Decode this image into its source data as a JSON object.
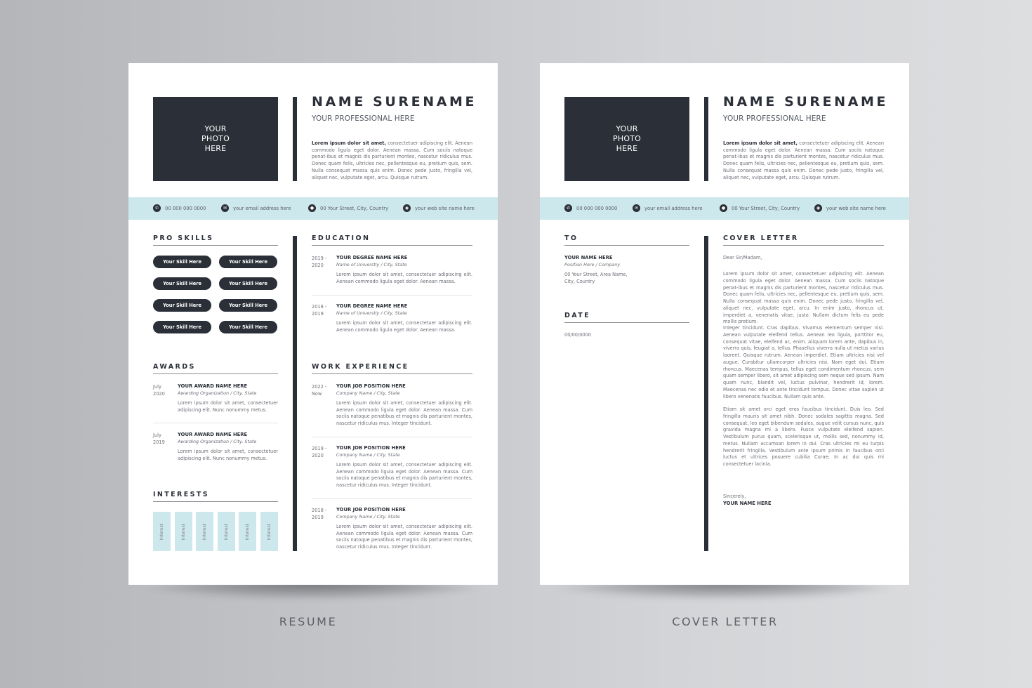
{
  "colors": {
    "dark": "#2b2f38",
    "accent_light_blue": "#cde8ec",
    "text_muted": "#6b6f76",
    "background_left": "#b5b6ba",
    "background_right": "#dddee0"
  },
  "header": {
    "photo_placeholder": "YOUR\nPHOTO\nHERE",
    "name": "NAME SURENAME",
    "profession": "YOUR PROFESSIONAL HERE",
    "intro_bold": "Lorem ipsum dolor sit amet,",
    "intro_rest": " consectetuer adipiscing elit. Aenean commodo ligula eget dolor. Aenean massa. Cum sociis natoque penat-ibus et magnis dis parturient montes, nascetur ridiculus mus. Donec quam felis, ultricies nec, pellentesque eu, pretium quis, sem. Nulla consequat massa quis enim. Donec pede justo, fringilla vel, aliquet nec, vulputate eget, arcu. Quisque rutrum."
  },
  "contact": [
    {
      "icon": "phone-icon",
      "glyph": "✆",
      "text": "00 000 000 0000"
    },
    {
      "icon": "email-icon",
      "glyph": "✉",
      "text": "your email address here"
    },
    {
      "icon": "location-pin-icon",
      "glyph": "●",
      "text": "00 Your Street, City, Country"
    },
    {
      "icon": "globe-icon",
      "glyph": "◉",
      "text": "your web site name here"
    }
  ],
  "resume": {
    "skills_title": "PRO SKILLS",
    "skills": [
      "Your Skill Here",
      "Your Skill Here",
      "Your Skill Here",
      "Your Skill Here",
      "Your Skill Here",
      "Your Skill Here",
      "Your Skill Here",
      "Your Skill Here"
    ],
    "awards_title": "AWARDS",
    "awards": [
      {
        "date": "July\n2020",
        "title": "YOUR AWARD NAME HERE",
        "org": "Awarding Organization / City, State",
        "desc": "Lorem ipsum dolor sit amet, consectetuer adipiscing elit. Nunc nonummy metus."
      },
      {
        "date": "July\n2019",
        "title": "YOUR AWARD NAME HERE",
        "org": "Awarding Organization / City, State",
        "desc": "Lorem ipsum dolor sit amet, consectetuer adipiscing elit. Nunc nonummy metus."
      }
    ],
    "interests_title": "INTERESTS",
    "interests": [
      "Interest",
      "Interest",
      "Interest",
      "Interest",
      "Interest",
      "Interest"
    ],
    "education_title": "EDUCATION",
    "education": [
      {
        "date": "2019 -\n2020",
        "title": "YOUR DEGREE NAME HERE",
        "school": "Name of Universtiy / City, State",
        "desc": "Lorem ipsum dolor sit amet, consectetuer adipiscing elit. Aenean commodo ligula eget dolor. Aenean massa."
      },
      {
        "date": "2018 -\n2019",
        "title": "YOUR DEGREE NAME HERE",
        "school": "Name of Universtiy / City, State",
        "desc": "Lorem ipsum dolor sit amet, consectetuer adipiscing elit. Aenean commodo ligula eget dolor. Aenean massa."
      }
    ],
    "work_title": "WORK EXPERIENCE",
    "work": [
      {
        "date": "2022 -\nNow",
        "title": "YOUR JOB POSITION HERE",
        "company": "Company Name / City, State",
        "desc": "Lorem ipsum dolor sit amet, consectetuer adipiscing elit. Aenean commodo ligula eget dolor. Aenean massa. Cum sociis natoque penatibus et magnis dis parturient montes, nascetur ridiculus mus. Integer tincidunt."
      },
      {
        "date": "2019 -\n2020",
        "title": "YOUR JOB POSITION HERE",
        "company": "Company Name / City, State",
        "desc": "Lorem ipsum dolor sit amet, consectetuer adipiscing elit. Aenean commodo ligula eget dolor. Aenean massa. Cum sociis natoque penatibus et magnis dis parturient montes, nascetur ridiculus mus. Integer tincidunt."
      },
      {
        "date": "2018 -\n2019",
        "title": "YOUR JOB POSITION HERE",
        "company": "Company Name / City, State",
        "desc": "Lorem ipsum dolor sit amet, consectetuer adipiscing elit. Aenean commodo ligula eget dolor. Aenean massa. Cum sociis natoque penatibus et magnis dis parturient montes, nascetur ridiculus mus. Integer tincidunt."
      }
    ]
  },
  "cover": {
    "to_title": "TO",
    "to_name": "YOUR NAME HERE",
    "to_position": "Position Here / Company",
    "to_address": "00 Your Street, Area Name,\nCity, Country",
    "date_title": "DATE",
    "date_value": "00/00/0000",
    "letter_title": "COVER LETTER",
    "greeting": "Dear Sir/Madam,",
    "paragraphs": [
      "Lorem ipsum dolor sit amet, consectetuer adipiscing elit. Aenean commodo ligula eget dolor. Aenean massa. Cum sociis natoque penat-ibus et magnis dis parturient montes, nascetur ridiculus mus. Donec quam felis, ultricies nec, pellentesque eu, pretium quis, sem. Nulla consequat massa quis enim. Donec pede justo, fringilla vel, aliquet nec, vulputate eget, arcu. In enim justo, rhoncus ut, imperdiet a, venenatis vitae, justo. Nullam dictum felis eu pede mollis pretium.",
      "Integer tincidunt. Cras dapibus. Vivamus elementum semper nisi. Aenean vulputate eleifend tellus. Aenean leo ligula, porttitor eu, consequat vitae, eleifend ac, enim. Aliquam lorem ante, dapibus in, viverra quis, feugiat a, tellus. Phasellus viverra nulla ut metus varius laoreet. Quisque rutrum. Aenean imperdiet. Etiam ultricies nisi vel augue. Curabitur ullamcorper ultricies nisi. Nam eget dui. Etiam rhoncus. Maecenas tempus, tellus eget condimentum rhoncus, sem quam semper libero, sit amet adipiscing sem neque sed ipsum. Nam quam nunc, blandit vel, luctus pulvinar, hendrerit id, lorem. Maecenas nec odio et ante tincidunt tempus. Donec vitae sapien ut libero venenatis faucibus. Nullam quis ante.",
      "Etiam sit amet orci eget eros faucibus tincidunt. Duis leo. Sed fringilla mauris sit amet nibh. Donec sodales sagittis magna. Sed consequat, leo eget bibendum sodales, augue velit cursus nunc, quis gravida magna mi a libero. Fusce vulputate eleifend sapien. Vestibulum purus quam, scelerisque ut, mollis sed, nonummy id, metus. Nullam accumsan lorem in dui. Cras ultricies mi eu turpis hendrerit fringilla. Vestibulum ante ipsum primis in faucibus orci luctus et ultrices posuere cubilia Curae; In ac dui quis mi consectetuer lacinia."
    ],
    "closing": "Sincerely,",
    "signature": "YOUR NAME HERE"
  },
  "captions": {
    "resume": "RESUME",
    "cover": "COVER LETTER"
  }
}
